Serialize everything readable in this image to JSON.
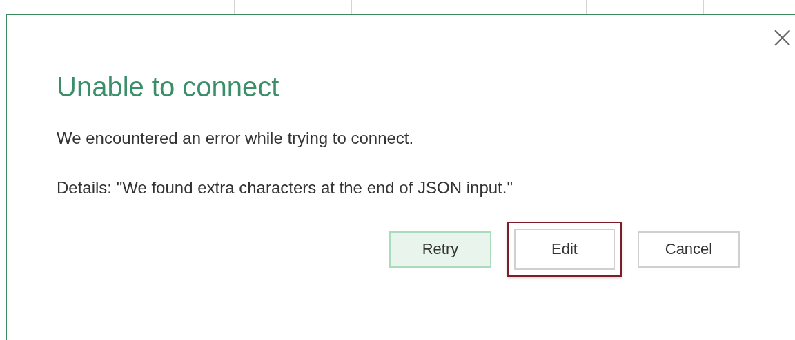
{
  "dialog": {
    "close": "×",
    "title": "Unable to connect",
    "message": "We encountered an error while trying to connect.",
    "details": "Details: \"We found extra characters at the end of JSON input.\"",
    "buttons": [
      {
        "label": "Retry",
        "default": true,
        "focused": false
      },
      {
        "label": "Edit",
        "default": false,
        "focused": true
      },
      {
        "label": "Cancel",
        "default": false,
        "focused": false
      }
    ]
  }
}
